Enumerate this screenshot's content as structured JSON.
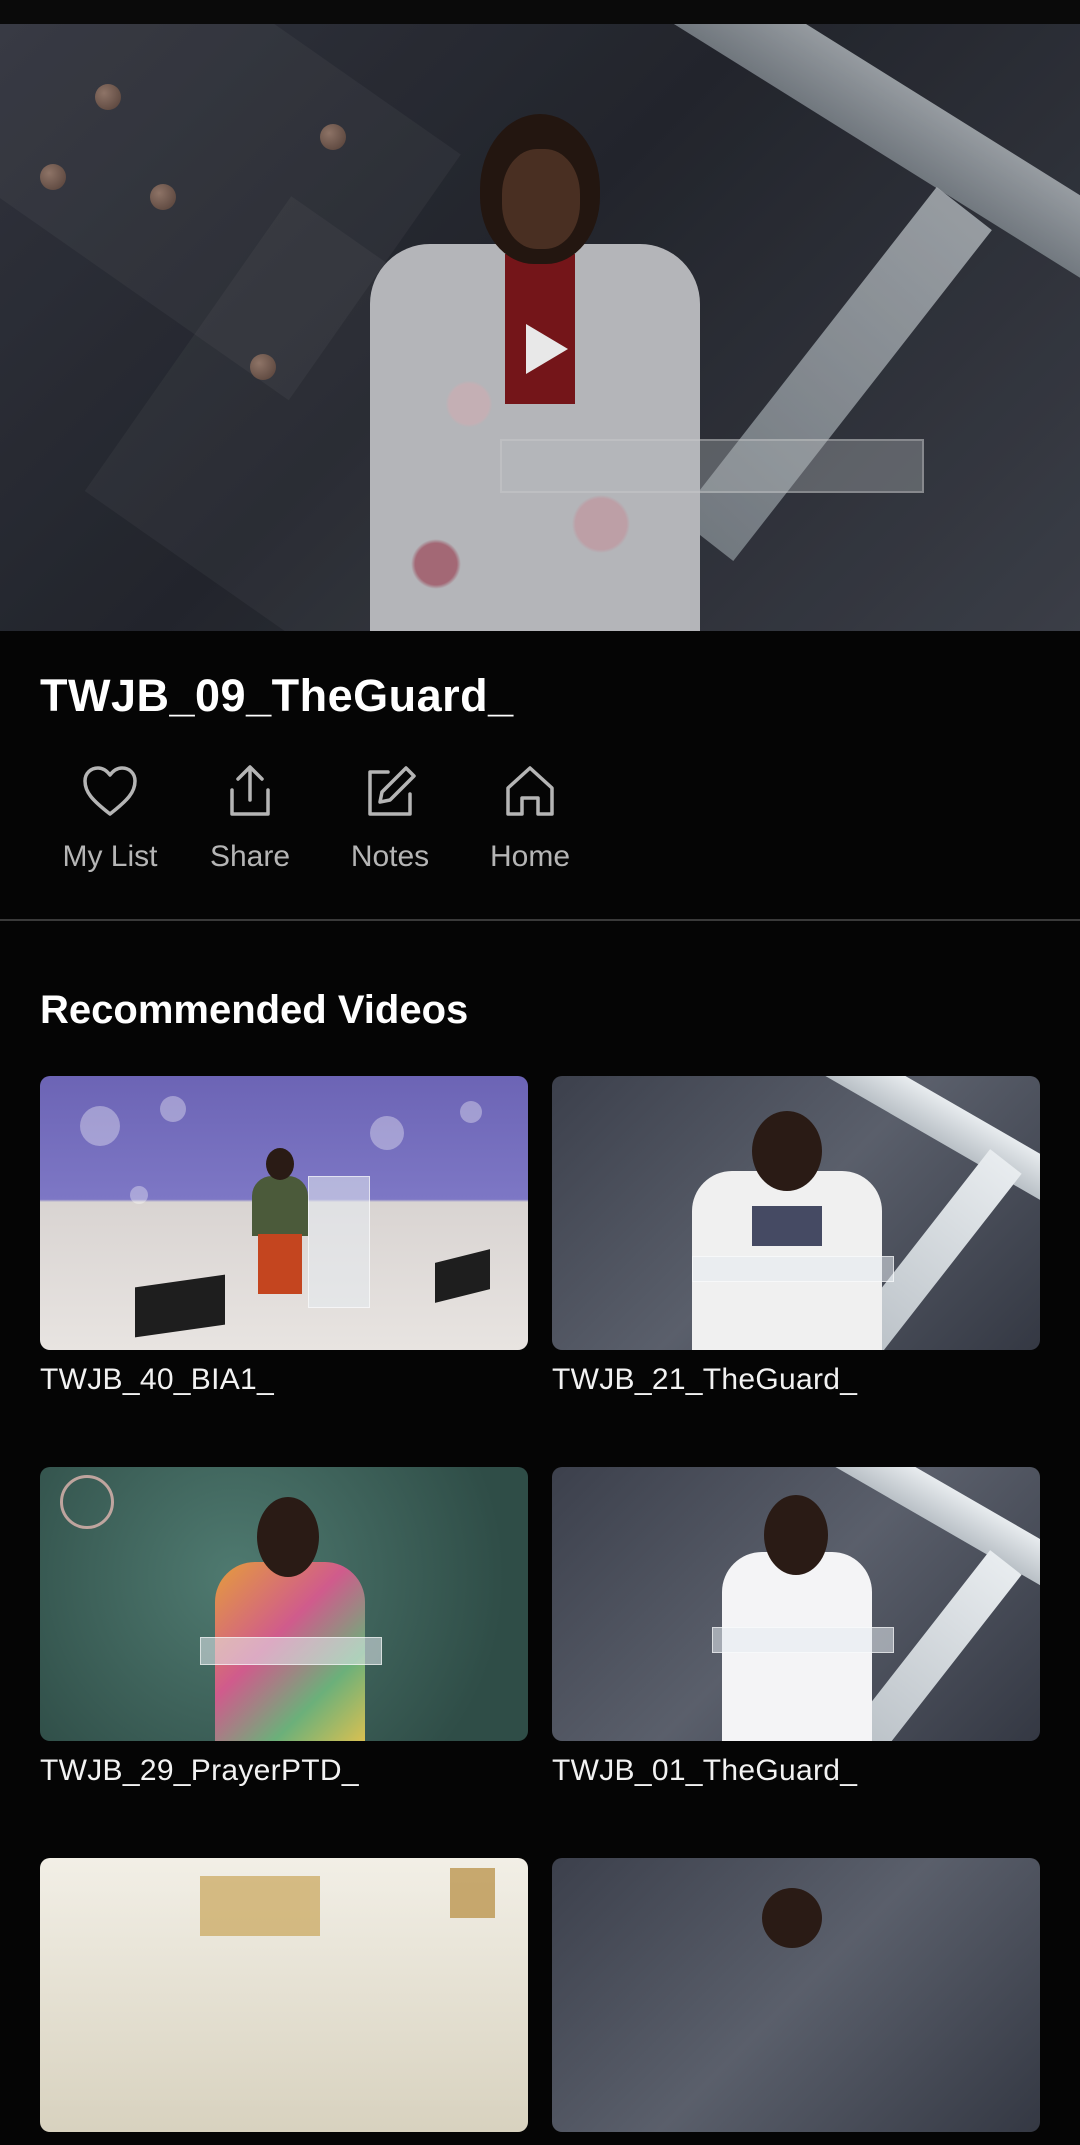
{
  "video": {
    "title": "TWJB_09_TheGuard_",
    "play_icon": "play-icon"
  },
  "actions": [
    {
      "label": "My List",
      "icon": "heart-icon"
    },
    {
      "label": "Share",
      "icon": "share-icon"
    },
    {
      "label": "Notes",
      "icon": "edit-icon"
    },
    {
      "label": "Home",
      "icon": "home-icon"
    }
  ],
  "recommended": {
    "heading": "Recommended Videos",
    "items": [
      {
        "title": "TWJB_40_BIA1_"
      },
      {
        "title": "TWJB_21_TheGuard_"
      },
      {
        "title": "TWJB_29_PrayerPTD_"
      },
      {
        "title": "TWJB_01_TheGuard_"
      },
      {
        "title": ""
      },
      {
        "title": ""
      }
    ]
  },
  "colors": {
    "background": "#050505",
    "text_primary": "#ffffff",
    "text_secondary": "#b5b5b5",
    "divider": "#3a3a3a"
  }
}
